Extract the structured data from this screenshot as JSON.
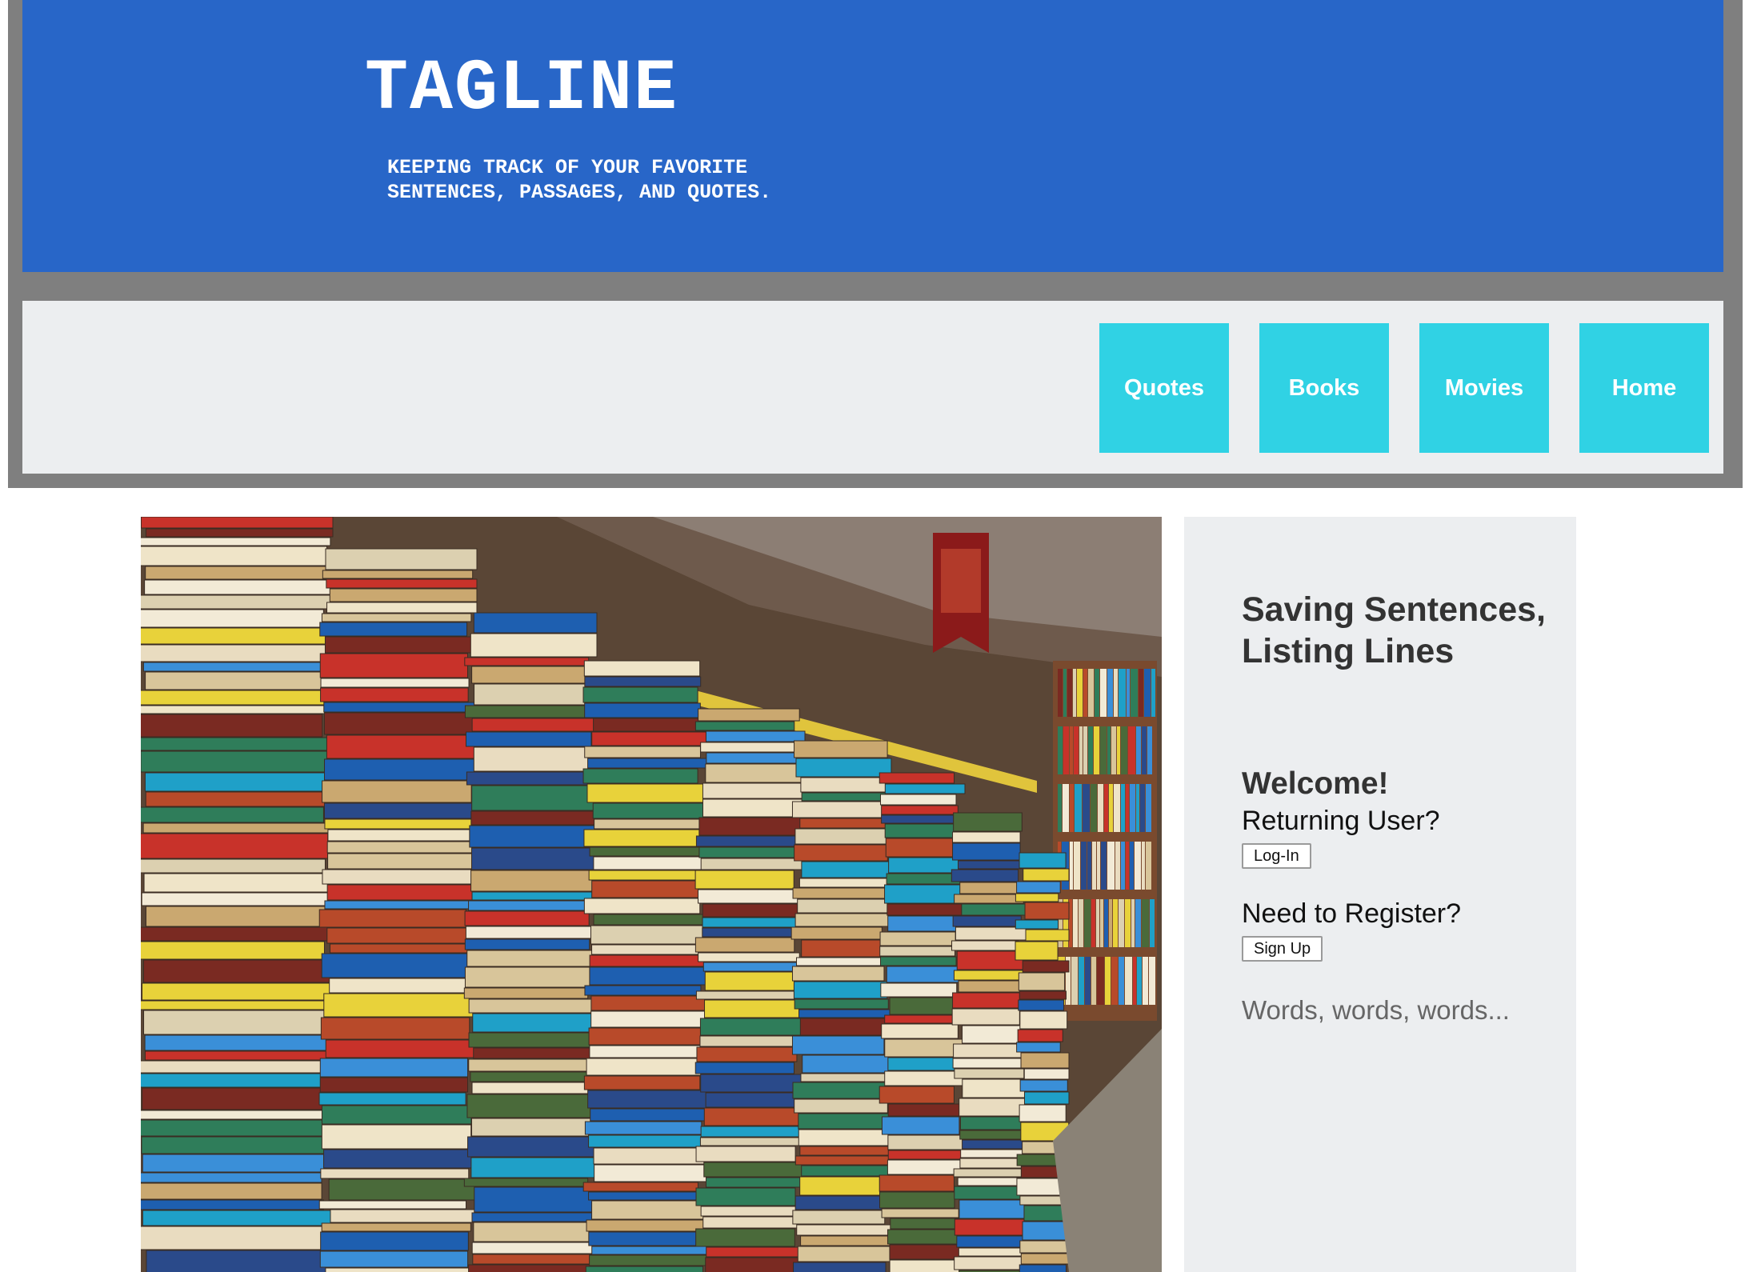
{
  "header": {
    "title": "TAGLINE",
    "subtitle": "Keeping track of your favorite sentences, passages, and quotes."
  },
  "nav": {
    "items": [
      {
        "label": "Quotes"
      },
      {
        "label": "Books"
      },
      {
        "label": "Movies"
      },
      {
        "label": "Home"
      }
    ]
  },
  "sidebar": {
    "title": "Saving Sentences, Listing Lines",
    "welcome": "Welcome!",
    "returning_prompt": "Returning User?",
    "login_label": "Log-In",
    "register_prompt": "Need to Register?",
    "signup_label": "Sign Up",
    "footer_text": "Words, words, words..."
  },
  "colors": {
    "banner": "#2866c8",
    "nav_button": "#30d2e4",
    "frame": "#7f7f7f",
    "panel": "#eceef0"
  }
}
